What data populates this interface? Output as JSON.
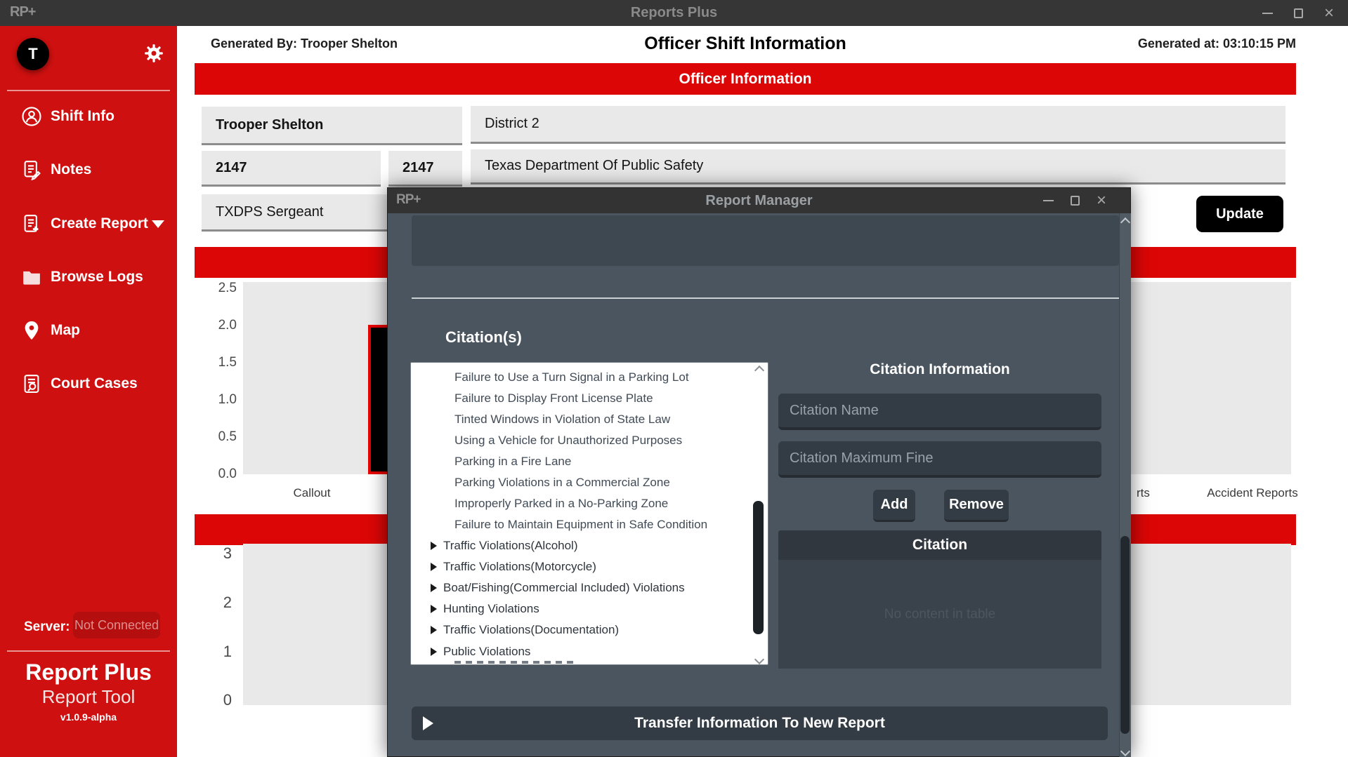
{
  "window": {
    "logo": "RP+",
    "title": "Reports Plus"
  },
  "sidebar": {
    "avatar_initial": "T",
    "items": [
      {
        "label": "Shift Info"
      },
      {
        "label": "Notes"
      },
      {
        "label": "Create Report"
      },
      {
        "label": "Browse Logs"
      },
      {
        "label": "Map"
      },
      {
        "label": "Court Cases"
      }
    ],
    "server_label": "Server:",
    "server_status": "Not Connected",
    "brand_title": "Report Plus",
    "brand_subtitle": "Report Tool",
    "brand_version": "v1.0.9-alpha"
  },
  "header": {
    "generated_by": "Generated By: Trooper Shelton",
    "title": "Officer Shift Information",
    "generated_at": "Generated at: 03:10:15 PM"
  },
  "officer": {
    "banner": "Officer Information",
    "name": "Trooper Shelton",
    "district": "District 2",
    "badge_number": "2147",
    "unit_number": "2147",
    "department": "Texas Department Of Public Safety",
    "rank": "TXDPS Sergeant",
    "update_label": "Update"
  },
  "charts": {
    "callout_chart": {
      "type": "bar",
      "y_ticks": [
        "2.5",
        "2.0",
        "1.5",
        "1.0",
        "0.5",
        "0.0"
      ],
      "visible_bar_value": 2.0,
      "bar_color": "#000000",
      "bar_border_color": "#e60000",
      "category_labels": [
        "Callout"
      ]
    },
    "category_row_right": [
      "rts",
      "Accident Reports"
    ],
    "bottom_chart": {
      "type": "bar",
      "y_ticks": [
        "3",
        "2",
        "1",
        "0"
      ]
    }
  },
  "modal": {
    "logo": "RP+",
    "title": "Report Manager",
    "citations_heading": "Citation(s)",
    "citation_list": {
      "items": [
        "Failure to Use a Turn Signal in a Parking Lot",
        "Failure to Display Front License Plate",
        "Tinted Windows in Violation of State Law",
        "Using a Vehicle for Unauthorized Purposes",
        "Parking in a Fire Lane",
        "Parking Violations in a Commercial Zone",
        "Improperly Parked in a No-Parking Zone",
        "Failure to Maintain Equipment in Safe Condition"
      ],
      "groups": [
        "Traffic Violations(Alcohol)",
        "Traffic Violations(Motorcycle)",
        "Boat/Fishing(Commercial Included) Violations",
        "Hunting Violations",
        "Traffic Violations(Documentation)",
        "Public Violations"
      ]
    },
    "citation_info": {
      "heading": "Citation Information",
      "name_placeholder": "Citation Name",
      "fine_placeholder": "Citation Maximum Fine",
      "add_label": "Add",
      "remove_label": "Remove",
      "table_header": "Citation",
      "empty_table_text": "No content in table"
    },
    "transfer_label": "Transfer Information To New Report"
  },
  "colors": {
    "accent_red_sidebar": "#ce1010",
    "accent_red_banner": "#dc0606",
    "titlebar": "#363636",
    "modal_body": "#4b555f",
    "panel_dark": "#333b44"
  }
}
